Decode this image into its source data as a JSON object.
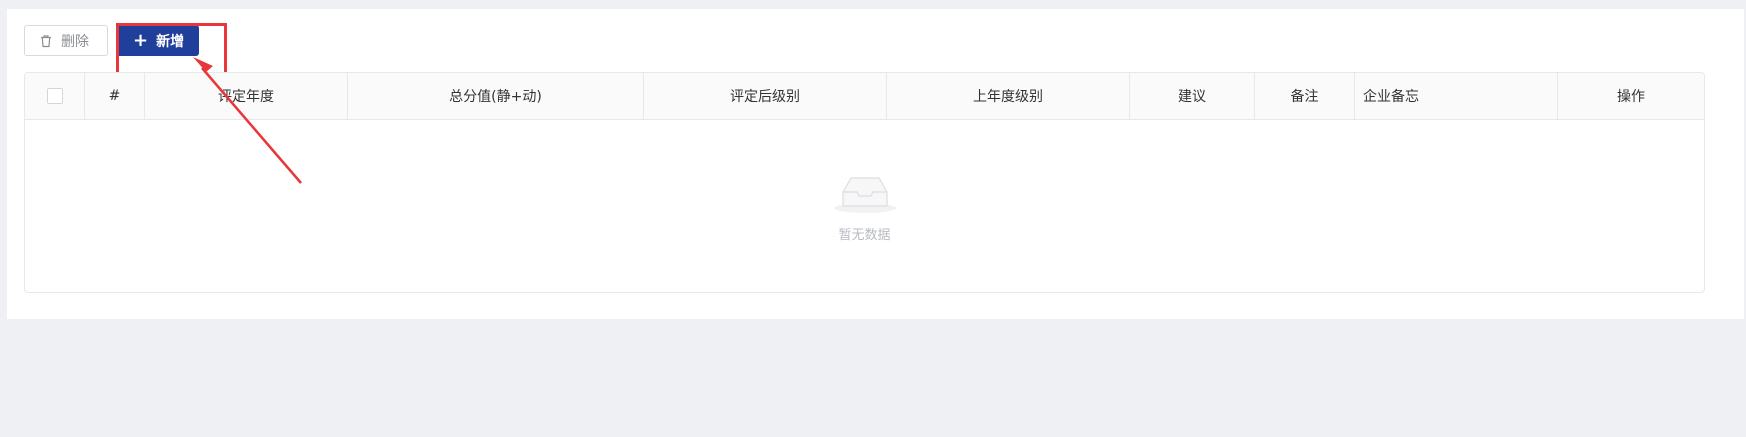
{
  "toolbar": {
    "delete_label": "删除",
    "add_label": "新增",
    "add_icon": "+"
  },
  "table": {
    "columns": [
      "#",
      "评定年度",
      "总分值(静+动)",
      "评定后级别",
      "上年度级别",
      "建议",
      "备注",
      "企业备忘",
      "操作"
    ],
    "empty_text": "暂无数据"
  },
  "colors": {
    "primary": "#203f9a",
    "annotation": "#e8363b"
  }
}
